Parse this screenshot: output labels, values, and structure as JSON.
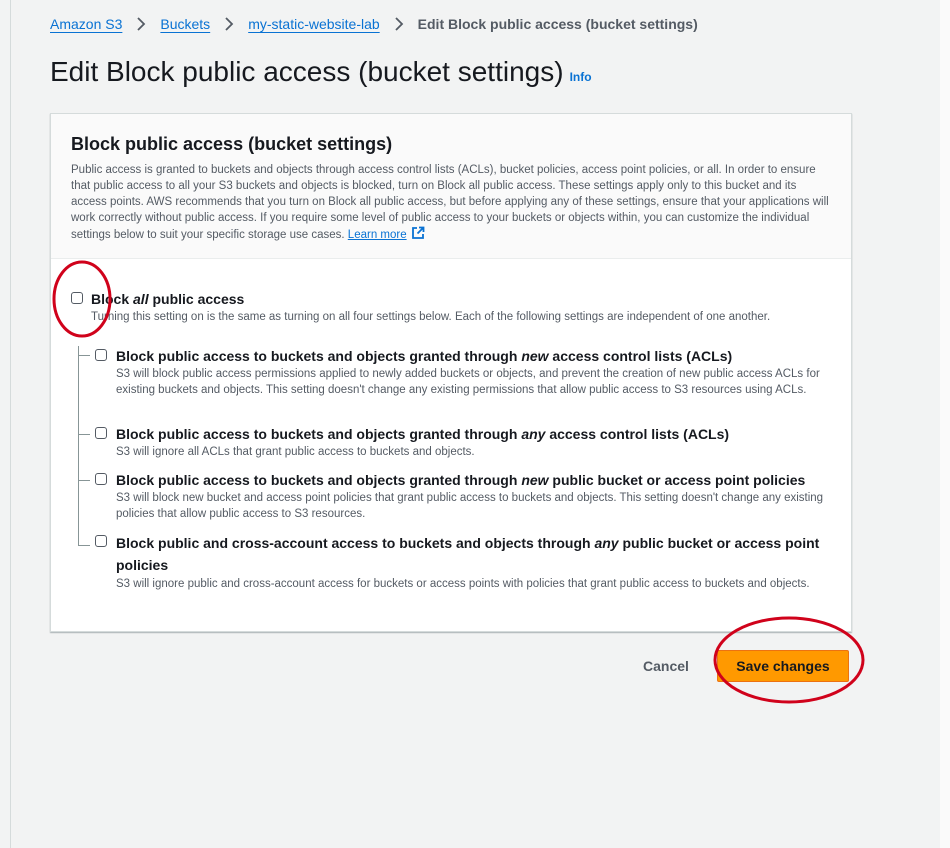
{
  "breadcrumb": {
    "items": [
      "Amazon S3",
      "Buckets",
      "my-static-website-lab"
    ],
    "current": "Edit Block public access (bucket settings)"
  },
  "page": {
    "title": "Edit Block public access (bucket settings)",
    "info": "Info"
  },
  "panel": {
    "title": "Block public access (bucket settings)",
    "description": "Public access is granted to buckets and objects through access control lists (ACLs), bucket policies, access point policies, or all. In order to ensure that public access to all your S3 buckets and objects is blocked, turn on Block all public access. These settings apply only to this bucket and its access points. AWS recommends that you turn on Block all public access, but before applying any of these settings, ensure that your applications will work correctly without public access. If you require some level of public access to your buckets or objects within, you can customize the individual settings below to suit your specific storage use cases.",
    "learn_more": "Learn more"
  },
  "block_all": {
    "pre": "Block ",
    "em": "all",
    "post": " public access",
    "checked": false,
    "description": "Turning this setting on is the same as turning on all four settings below. Each of the following settings are independent of one another."
  },
  "settings": [
    {
      "pre": "Block public access to buckets and objects granted through ",
      "em": "new",
      "post": " access control lists (ACLs)",
      "checked": false,
      "description": "S3 will block public access permissions applied to newly added buckets or objects, and prevent the creation of new public access ACLs for existing buckets and objects. This setting doesn't change any existing permissions that allow public access to S3 resources using ACLs."
    },
    {
      "pre": "Block public access to buckets and objects granted through ",
      "em": "any",
      "post": " access control lists (ACLs)",
      "checked": false,
      "description": "S3 will ignore all ACLs that grant public access to buckets and objects."
    },
    {
      "pre": "Block public access to buckets and objects granted through ",
      "em": "new",
      "post": " public bucket or access point policies",
      "checked": false,
      "description": "S3 will block new bucket and access point policies that grant public access to buckets and objects. This setting doesn't change any existing policies that allow public access to S3 resources."
    },
    {
      "pre": "Block public and cross-account access to buckets and objects through ",
      "em": "any",
      "post": " public bucket or access point policies",
      "checked": false,
      "description": "S3 will ignore public and cross-account access for buckets or access points with policies that grant public access to buckets and objects."
    }
  ],
  "actions": {
    "cancel": "Cancel",
    "save": "Save changes"
  },
  "colors": {
    "link": "#0972d3",
    "primary_button": "#ff9900",
    "annotation": "#d0021b"
  },
  "icons": [
    "chevron-right-icon",
    "external-link-icon"
  ]
}
